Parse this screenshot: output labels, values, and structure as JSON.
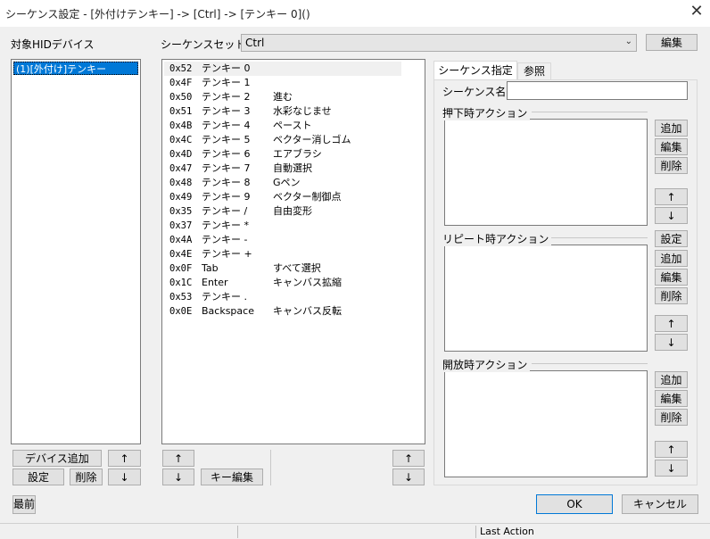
{
  "window": {
    "title": "シーケンス設定 - [外付けテンキー] -> [Ctrl] -> [テンキー 0]()",
    "close_glyph": "✕"
  },
  "left": {
    "label": "対象HIDデバイス",
    "devices": [
      "(1)[外付け]テンキー"
    ],
    "add_device_label": "デバイス追加",
    "settings_label": "設定",
    "delete_label": "削除",
    "up_label": "↑",
    "down_label": "↓"
  },
  "sequence_set": {
    "label": "シーケンスセット",
    "value": "Ctrl",
    "edit_label": "編集",
    "dropdown_glyph": "⌄"
  },
  "sequences": [
    {
      "code": "0x52",
      "key": "テンキー 0",
      "action": ""
    },
    {
      "code": "0x4F",
      "key": "テンキー 1",
      "action": ""
    },
    {
      "code": "0x50",
      "key": "テンキー 2",
      "action": "進む"
    },
    {
      "code": "0x51",
      "key": "テンキー 3",
      "action": "水彩なじませ"
    },
    {
      "code": "0x4B",
      "key": "テンキー 4",
      "action": "ペースト"
    },
    {
      "code": "0x4C",
      "key": "テンキー 5",
      "action": "ベクター消しゴム"
    },
    {
      "code": "0x4D",
      "key": "テンキー 6",
      "action": "エアブラシ"
    },
    {
      "code": "0x47",
      "key": "テンキー 7",
      "action": "自動選択"
    },
    {
      "code": "0x48",
      "key": "テンキー 8",
      "action": "Gペン"
    },
    {
      "code": "0x49",
      "key": "テンキー 9",
      "action": "ベクター制御点"
    },
    {
      "code": "0x35",
      "key": "テンキー /",
      "action": "自由変形"
    },
    {
      "code": "0x37",
      "key": "テンキー *",
      "action": ""
    },
    {
      "code": "0x4A",
      "key": "テンキー -",
      "action": ""
    },
    {
      "code": "0x4E",
      "key": "テンキー +",
      "action": ""
    },
    {
      "code": "0x0F",
      "key": "Tab",
      "action": "すべて選択"
    },
    {
      "code": "0x1C",
      "key": "Enter",
      "action": "キャンバス拡縮"
    },
    {
      "code": "0x53",
      "key": "テンキー .",
      "action": ""
    },
    {
      "code": "0x0E",
      "key": "Backspace",
      "action": "キャンバス反転"
    }
  ],
  "middle_buttons": {
    "up_label": "↑",
    "down_label": "↓",
    "key_edit_label": "キー編集",
    "right_up_label": "↑",
    "right_down_label": "↓"
  },
  "tabs": {
    "active": "シーケンス指定",
    "inactive": "参照"
  },
  "right": {
    "seq_name_label": "シーケンス名",
    "seq_name_value": "",
    "press_label": "押下時アクション",
    "repeat_label": "リピート時アクション",
    "release_label": "開放時アクション",
    "add_label": "追加",
    "edit_label": "編集",
    "delete_label": "削除",
    "settings_label": "設定",
    "up_label": "↑",
    "down_label": "↓"
  },
  "footer": {
    "topmost_label": "最前",
    "ok_label": "OK",
    "cancel_label": "キャンセル"
  },
  "status": {
    "text": "Last Action"
  }
}
